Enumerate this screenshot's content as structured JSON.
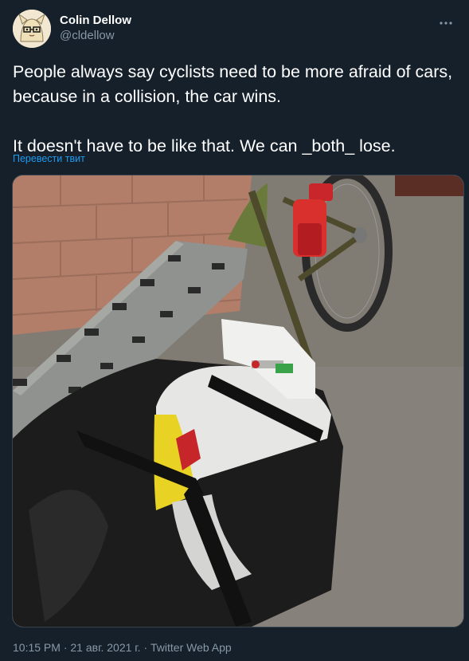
{
  "author": {
    "display_name": "Colin Dellow",
    "handle": "@cldellow"
  },
  "tweet": {
    "text": "People always say cyclists need to be more afraid of cars, because in a collision, the car wins.\n\nIt doesn't have to be like that. We can _both_ lose.",
    "translate_label": "Перевести твит"
  },
  "meta": {
    "time": "10:15 PM",
    "date": "21 авг. 2021 г.",
    "source": "Twitter Web App",
    "separator": "·"
  },
  "icons": {
    "more": "more-horizontal-icon"
  },
  "colors": {
    "background": "#15202b",
    "link": "#1d9bf0",
    "muted": "#8899a6"
  }
}
